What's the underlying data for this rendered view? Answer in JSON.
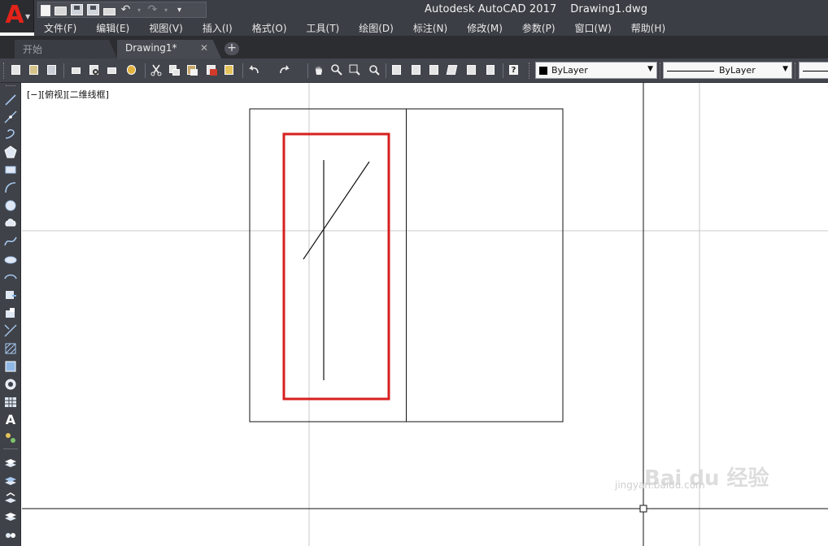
{
  "window": {
    "app_title": "Autodesk AutoCAD 2017",
    "file_name": "Drawing1.dwg",
    "app_logo": "A"
  },
  "menu": {
    "items": [
      "文件(F)",
      "编辑(E)",
      "视图(V)",
      "插入(I)",
      "格式(O)",
      "工具(T)",
      "绘图(D)",
      "标注(N)",
      "修改(M)",
      "参数(P)",
      "窗口(W)",
      "帮助(H)"
    ]
  },
  "tabs": {
    "start_label": "开始",
    "drawing_label": "Drawing1*",
    "close_glyph": "✕",
    "add_glyph": "+"
  },
  "properties": {
    "color_value": "ByLayer",
    "linetype_value": "ByLayer"
  },
  "viewport": {
    "label": "[−][俯视][二维线框]"
  },
  "watermark": {
    "logo": "Bai du 经验",
    "url": "jingyan.baidu.com"
  },
  "colors": {
    "highlight_box": "#d71f1f",
    "chrome_dark": "#3b3e44"
  }
}
